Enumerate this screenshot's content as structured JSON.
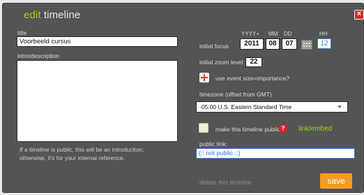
{
  "dialog": {
    "title_prefix": "edit",
    "title_suffix": "timeline",
    "close_label": "×"
  },
  "left": {
    "title_label": "title",
    "title_value": "Voorbeeld cursus",
    "intro_label": "intro/description",
    "help_text_line1": "If a timeline is  public, this will be an introduction;",
    "help_text_line2": "otherwise, it's for your internal reference."
  },
  "right": {
    "initial_focus_label": "initial  focus",
    "date_headers": {
      "year": "YYYY+",
      "month": "MM",
      "day": "DD",
      "hour": "HH"
    },
    "date_values": {
      "year": "2011",
      "month": "08",
      "day": "07",
      "hour": "12"
    },
    "zoom_label": "initial zoom level",
    "zoom_value": "22",
    "event_size_label": "use event size=importance?",
    "timezone_label": "timezone (offset from GMT)",
    "timezone_value": "-05:00 U.S. Eastern Standard Time",
    "public_question": "make this timeline public?",
    "help_icon": "?",
    "link_embed": "link/embed",
    "public_link_label": "public link:",
    "public_link_value": "(:: not public ::)",
    "delete_label": "delete this timeline",
    "save_label": "save"
  },
  "colors": {
    "accent_green": "#9bd31b",
    "save_orange": "#f39b22",
    "close_red": "#c8322c",
    "link_blue": "#2b7bd8"
  },
  "icons": [
    "close-icon",
    "calendar-icon",
    "plus-icon",
    "help-icon",
    "dropdown-arrow-icon"
  ]
}
